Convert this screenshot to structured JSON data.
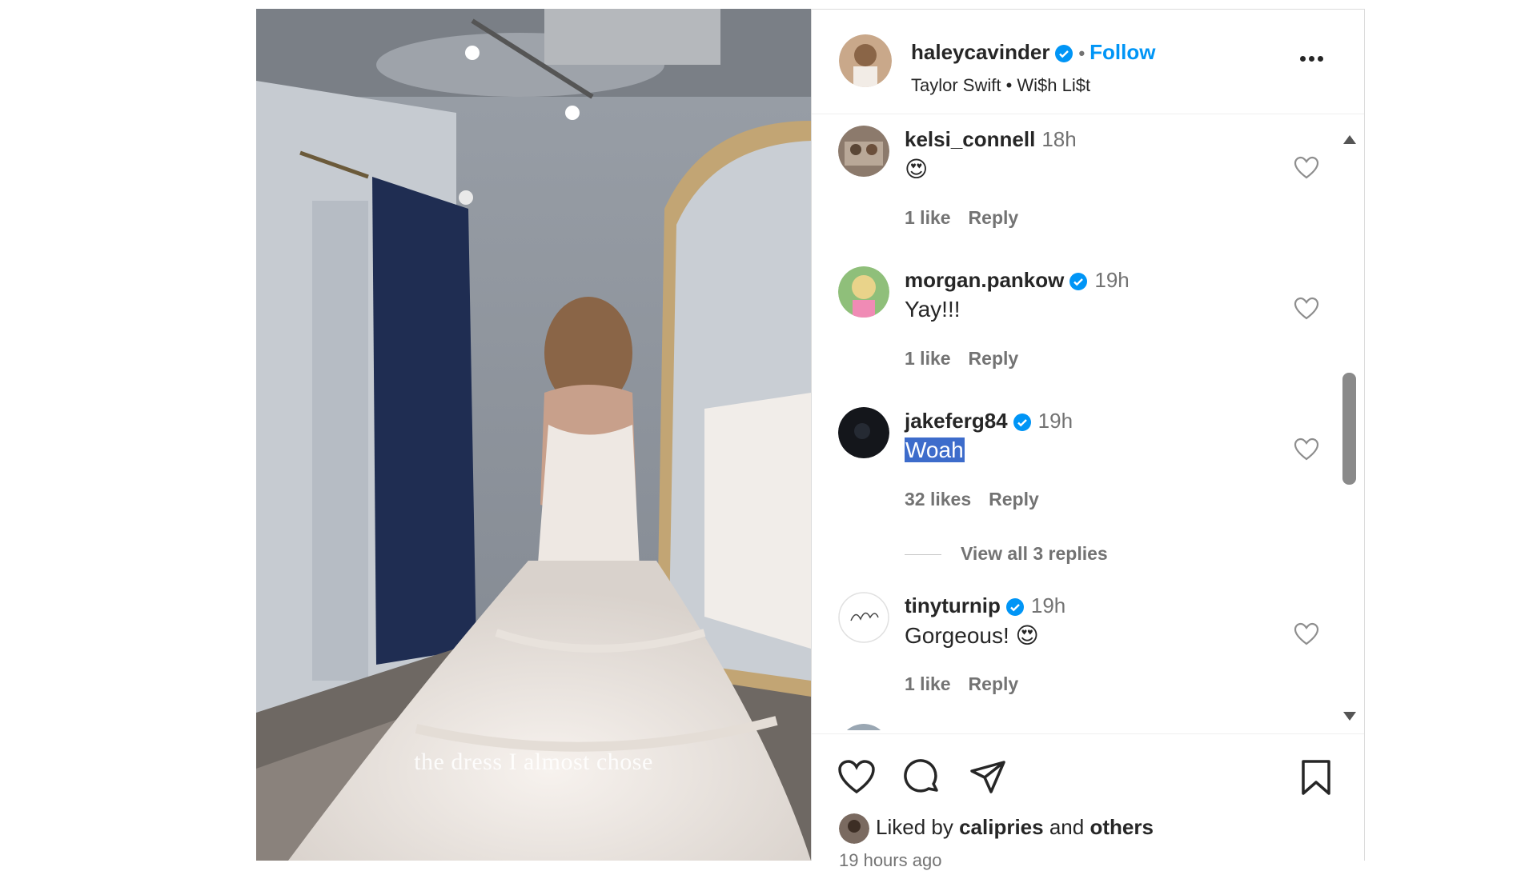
{
  "post": {
    "username": "haleycavinder",
    "follow_label": "Follow",
    "audio": "Taylor Swift • Wi$h Li$t",
    "overlay_caption": "the dress I almost chose"
  },
  "comments": [
    {
      "user": "kelsi_connell",
      "time": "18h",
      "text": "😍",
      "likes": "1 like",
      "reply": "Reply",
      "verified": false
    },
    {
      "user": "morgan.pankow",
      "time": "19h",
      "text": "Yay!!!",
      "likes": "1 like",
      "reply": "Reply",
      "verified": true
    },
    {
      "user": "jakeferg84",
      "time": "19h",
      "text": "Woah",
      "likes": "32 likes",
      "reply": "Reply",
      "verified": true,
      "view_replies": "View all 3 replies"
    },
    {
      "user": "tinyturnip",
      "time": "19h",
      "text": "Gorgeous! 😍",
      "likes": "1 like",
      "reply": "Reply",
      "verified": true
    }
  ],
  "footer": {
    "liked_prefix": "Liked by",
    "liked_user": "calipries",
    "liked_and": "and",
    "liked_others": "others",
    "timestamp": "19 hours ago"
  },
  "colors": {
    "accent": "#0095f6",
    "selection": "#3d6ccb",
    "muted": "#737373"
  },
  "icons": [
    "verified-badge-icon",
    "more-options-icon",
    "heart-icon",
    "comment-icon",
    "share-icon",
    "bookmark-icon"
  ]
}
